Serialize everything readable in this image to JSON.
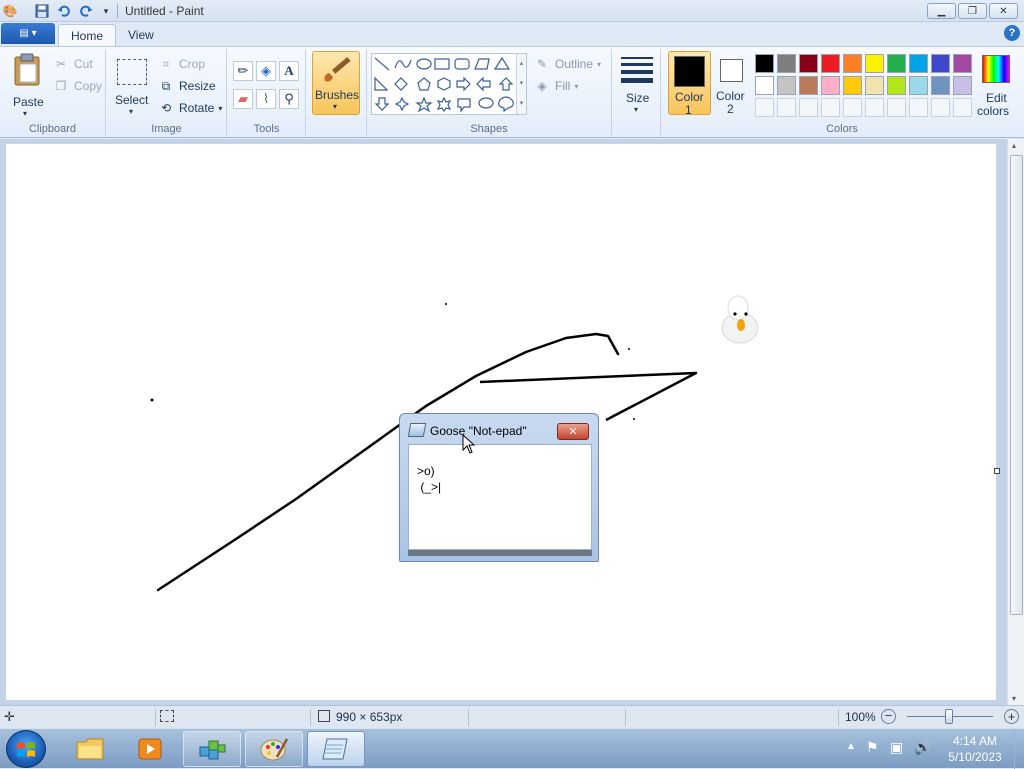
{
  "window": {
    "title": "Untitled - Paint",
    "controls": {
      "minimize": "▁",
      "restore": "❐",
      "close": "✕"
    }
  },
  "tabs": {
    "file": "▤ ▾",
    "home": "Home",
    "view": "View"
  },
  "ribbon": {
    "clipboard": {
      "label": "Clipboard",
      "paste": "Paste",
      "cut": "Cut",
      "copy": "Copy"
    },
    "image": {
      "label": "Image",
      "select": "Select",
      "crop": "Crop",
      "resize": "Resize",
      "rotate": "Rotate"
    },
    "tools": {
      "label": "Tools"
    },
    "brushes": {
      "label": "Brushes"
    },
    "shapes": {
      "label": "Shapes",
      "outline": "Outline",
      "fill": "Fill"
    },
    "size": {
      "label": "Size"
    },
    "color1": {
      "line1": "Color",
      "line2": "1",
      "value": "#000000"
    },
    "color2": {
      "line1": "Color",
      "line2": "2",
      "value": "#ffffff"
    },
    "colors": {
      "label": "Colors",
      "edit_line1": "Edit",
      "edit_line2": "colors",
      "row1": [
        "#000000",
        "#7f7f7f",
        "#880015",
        "#ed1c24",
        "#ff7f27",
        "#fff200",
        "#22b14c",
        "#00a2e8",
        "#3f48cc",
        "#a349a4"
      ],
      "row2": [
        "#ffffff",
        "#c3c3c3",
        "#b97a57",
        "#ffaec9",
        "#ffc90e",
        "#efe4b0",
        "#b5e61d",
        "#99d9ea",
        "#7092be",
        "#c8bfe7"
      ]
    }
  },
  "goose_window": {
    "title": "Goose \"Not-epad\"",
    "close": "✕",
    "text_line1": ">o)",
    "text_line2": " (_>|"
  },
  "status": {
    "canvas_size": "990 × 653px",
    "zoom": "100%"
  },
  "taskbar": {
    "time": "4:14 AM",
    "date": "5/10/2023"
  }
}
